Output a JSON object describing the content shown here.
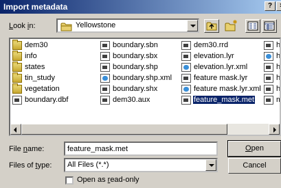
{
  "window": {
    "title": "Import metadata",
    "help_label": "?",
    "close_label": "×"
  },
  "look_in": {
    "label": "Look in:",
    "value": "Yellowstone",
    "icon": "folder-icon"
  },
  "toolbar": {
    "up_icon": "up-one-level-icon",
    "new_folder_icon": "new-folder-icon",
    "list_view_icon": "list-view-icon",
    "details_view_icon": "details-view-icon"
  },
  "files": {
    "columns": [
      [
        {
          "name": "dem30",
          "type": "folder"
        },
        {
          "name": "info",
          "type": "folder"
        },
        {
          "name": "states",
          "type": "folder"
        },
        {
          "name": "tin_study",
          "type": "folder"
        },
        {
          "name": "vegetation",
          "type": "folder"
        },
        {
          "name": "boundary.dbf",
          "type": "file"
        }
      ],
      [
        {
          "name": "boundary.sbn",
          "type": "file"
        },
        {
          "name": "boundary.sbx",
          "type": "file"
        },
        {
          "name": "boundary.shp",
          "type": "file"
        },
        {
          "name": "boundary.shp.xml",
          "type": "xml"
        },
        {
          "name": "boundary.shx",
          "type": "file"
        },
        {
          "name": "dem30.aux",
          "type": "file"
        }
      ],
      [
        {
          "name": "dem30.rrd",
          "type": "file"
        },
        {
          "name": "elevation.lyr",
          "type": "file"
        },
        {
          "name": "elevation.lyr.xml",
          "type": "xml"
        },
        {
          "name": "feature mask.lyr",
          "type": "file"
        },
        {
          "name": "feature mask.lyr.xml",
          "type": "xml"
        },
        {
          "name": "feature_mask.met",
          "type": "file",
          "selected": true
        }
      ],
      [
        {
          "name": "hills",
          "type": "file"
        },
        {
          "name": "hills",
          "type": "xml"
        },
        {
          "name": "hills",
          "type": "file"
        },
        {
          "name": "hy",
          "type": "file"
        },
        {
          "name": "hy",
          "type": "file"
        },
        {
          "name": "ma",
          "type": "file"
        }
      ]
    ]
  },
  "form": {
    "file_name_label": "File name:",
    "file_name_value": "feature_mask.met",
    "file_type_label": "Files of type:",
    "file_type_value": "All Files (*.*)",
    "open_label": "Open",
    "cancel_label": "Cancel",
    "readonly_label": "Open as read-only"
  }
}
